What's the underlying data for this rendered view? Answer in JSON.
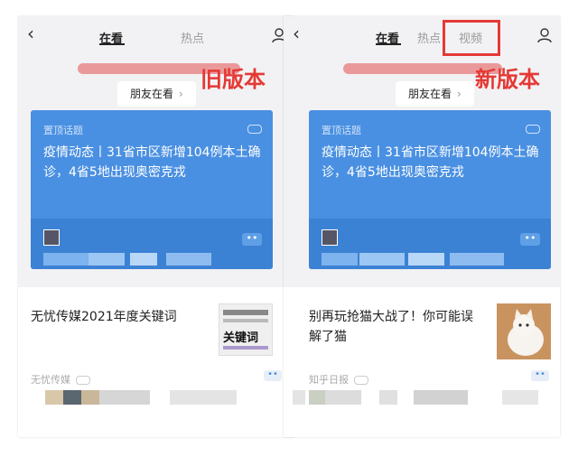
{
  "old": {
    "tabs": {
      "active": "在看",
      "other": "热点"
    },
    "friends_label": "朋友在看",
    "annotation": "旧版本",
    "topic": {
      "label": "置顶话题",
      "title": "疫情动态丨31省市区新增104例本土确诊，4省5地出现奥密克戎"
    },
    "article": {
      "title": "无忧传媒2021年度关键词",
      "source": "无忧传媒",
      "thumb_text": "关键词"
    }
  },
  "new": {
    "tabs": {
      "active": "在看",
      "other": "热点",
      "video": "视频"
    },
    "friends_label": "朋友在看",
    "annotation": "新版本",
    "topic": {
      "label": "置顶话题",
      "title": "疫情动态丨31省市区新增104例本土确诊，4省5地出现奥密克戎"
    },
    "article": {
      "title": "别再玩抢猫大战了！你可能误解了猫",
      "source": "知乎日报"
    }
  },
  "colors": {
    "annotation_red": "#e53935",
    "topic_blue": "#4a90e2"
  }
}
